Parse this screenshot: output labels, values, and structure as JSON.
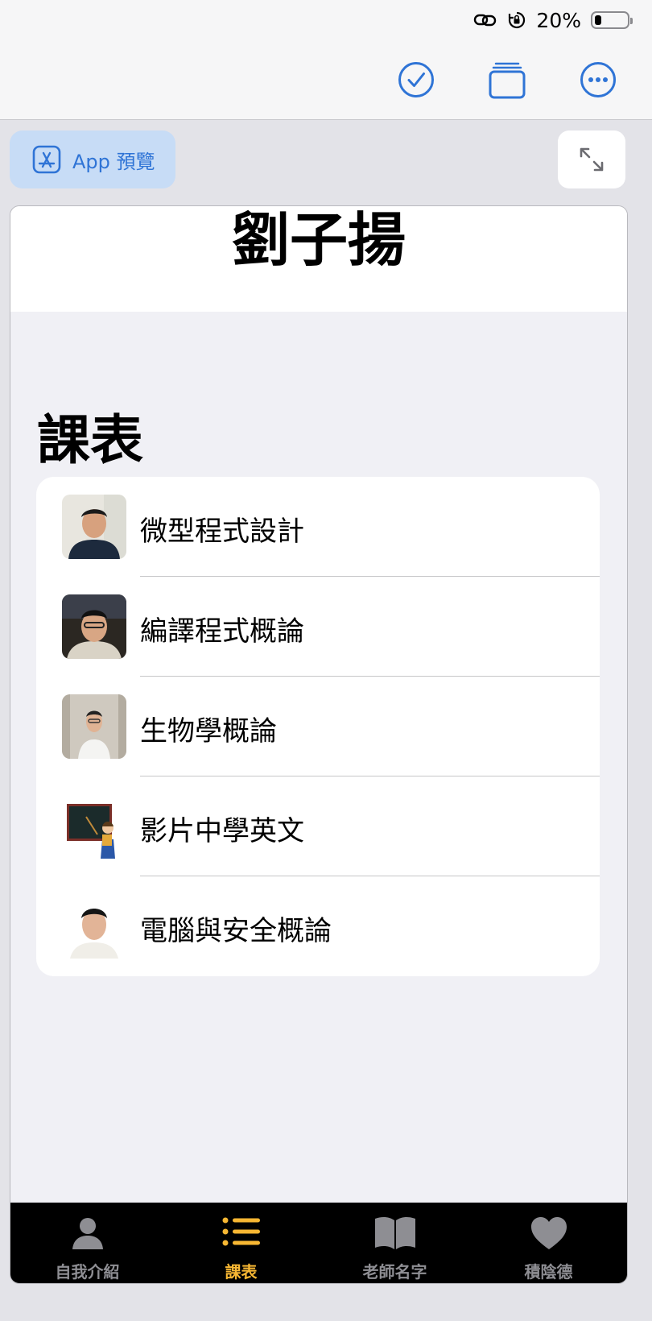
{
  "status_bar": {
    "battery_text": "20%",
    "battery_level": 0.2,
    "icons": [
      "link-icon",
      "rotation-lock-icon",
      "battery-icon"
    ]
  },
  "toolbar": {
    "icons": [
      "checkmark-circle-icon",
      "tabs-stack-icon",
      "more-ellipsis-icon"
    ],
    "accent": "#2f74d6"
  },
  "preview": {
    "label": "App 預覽",
    "icon": "app-store-icon"
  },
  "app": {
    "title": "劉子揚",
    "section_title": "課表",
    "courses": [
      {
        "label": "微型程式設計",
        "thumb": "teacher-photo"
      },
      {
        "label": "編譯程式概論",
        "thumb": "teacher-photo"
      },
      {
        "label": "生物學概論",
        "thumb": "teacher-photo"
      },
      {
        "label": "影片中學英文",
        "thumb": "teacher-cartoon"
      },
      {
        "label": "電腦與安全概論",
        "thumb": "teacher-photo"
      }
    ],
    "tabs": [
      {
        "label": "自我介紹",
        "icon": "person-icon"
      },
      {
        "label": "課表",
        "icon": "list-icon",
        "active": true
      },
      {
        "label": "老師名字",
        "icon": "book-icon"
      },
      {
        "label": "積陰德",
        "icon": "heart-icon"
      }
    ],
    "active_tab_color": "#f7b733"
  }
}
